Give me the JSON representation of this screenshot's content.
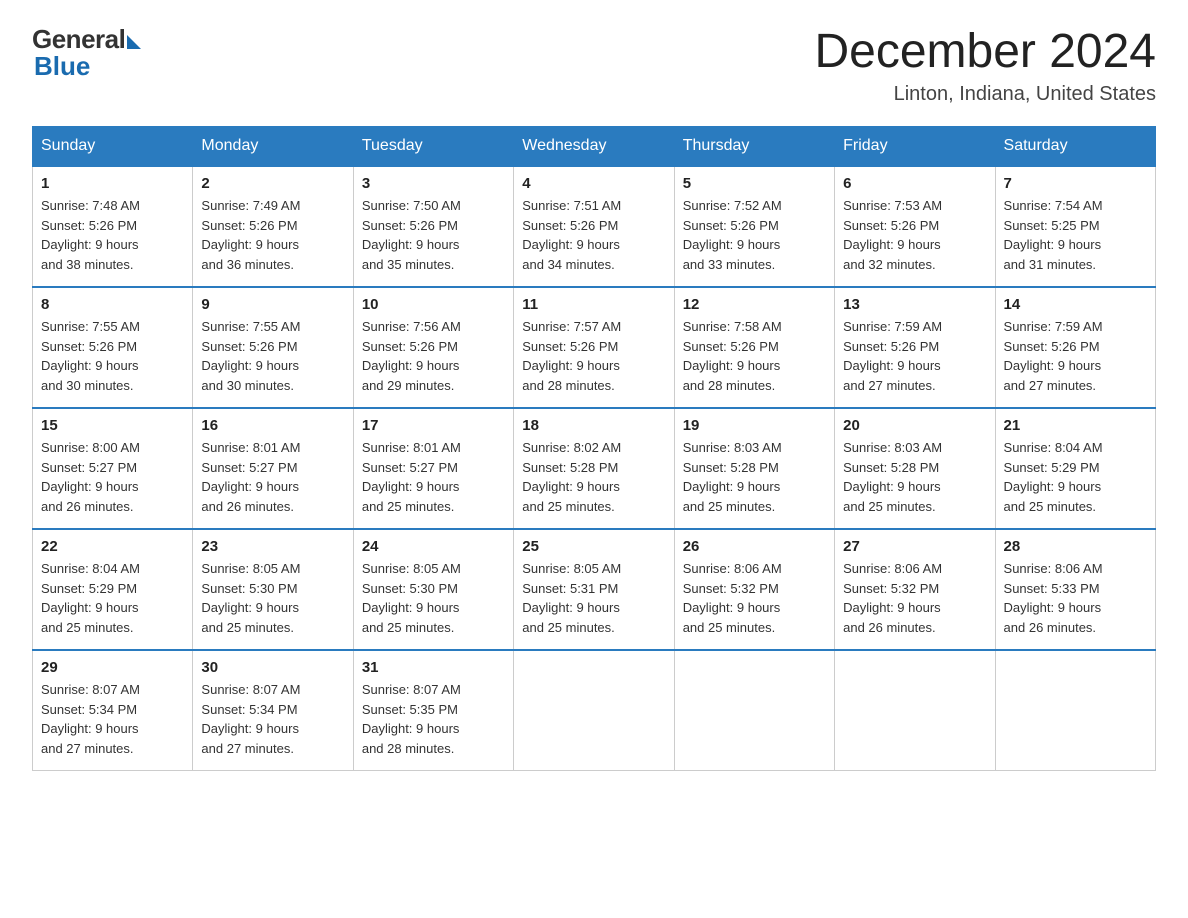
{
  "logo": {
    "general": "General",
    "blue": "Blue"
  },
  "title": "December 2024",
  "location": "Linton, Indiana, United States",
  "days_of_week": [
    "Sunday",
    "Monday",
    "Tuesday",
    "Wednesday",
    "Thursday",
    "Friday",
    "Saturday"
  ],
  "weeks": [
    [
      {
        "day": "1",
        "sunrise": "7:48 AM",
        "sunset": "5:26 PM",
        "daylight": "9 hours and 38 minutes."
      },
      {
        "day": "2",
        "sunrise": "7:49 AM",
        "sunset": "5:26 PM",
        "daylight": "9 hours and 36 minutes."
      },
      {
        "day": "3",
        "sunrise": "7:50 AM",
        "sunset": "5:26 PM",
        "daylight": "9 hours and 35 minutes."
      },
      {
        "day": "4",
        "sunrise": "7:51 AM",
        "sunset": "5:26 PM",
        "daylight": "9 hours and 34 minutes."
      },
      {
        "day": "5",
        "sunrise": "7:52 AM",
        "sunset": "5:26 PM",
        "daylight": "9 hours and 33 minutes."
      },
      {
        "day": "6",
        "sunrise": "7:53 AM",
        "sunset": "5:26 PM",
        "daylight": "9 hours and 32 minutes."
      },
      {
        "day": "7",
        "sunrise": "7:54 AM",
        "sunset": "5:25 PM",
        "daylight": "9 hours and 31 minutes."
      }
    ],
    [
      {
        "day": "8",
        "sunrise": "7:55 AM",
        "sunset": "5:26 PM",
        "daylight": "9 hours and 30 minutes."
      },
      {
        "day": "9",
        "sunrise": "7:55 AM",
        "sunset": "5:26 PM",
        "daylight": "9 hours and 30 minutes."
      },
      {
        "day": "10",
        "sunrise": "7:56 AM",
        "sunset": "5:26 PM",
        "daylight": "9 hours and 29 minutes."
      },
      {
        "day": "11",
        "sunrise": "7:57 AM",
        "sunset": "5:26 PM",
        "daylight": "9 hours and 28 minutes."
      },
      {
        "day": "12",
        "sunrise": "7:58 AM",
        "sunset": "5:26 PM",
        "daylight": "9 hours and 28 minutes."
      },
      {
        "day": "13",
        "sunrise": "7:59 AM",
        "sunset": "5:26 PM",
        "daylight": "9 hours and 27 minutes."
      },
      {
        "day": "14",
        "sunrise": "7:59 AM",
        "sunset": "5:26 PM",
        "daylight": "9 hours and 27 minutes."
      }
    ],
    [
      {
        "day": "15",
        "sunrise": "8:00 AM",
        "sunset": "5:27 PM",
        "daylight": "9 hours and 26 minutes."
      },
      {
        "day": "16",
        "sunrise": "8:01 AM",
        "sunset": "5:27 PM",
        "daylight": "9 hours and 26 minutes."
      },
      {
        "day": "17",
        "sunrise": "8:01 AM",
        "sunset": "5:27 PM",
        "daylight": "9 hours and 25 minutes."
      },
      {
        "day": "18",
        "sunrise": "8:02 AM",
        "sunset": "5:28 PM",
        "daylight": "9 hours and 25 minutes."
      },
      {
        "day": "19",
        "sunrise": "8:03 AM",
        "sunset": "5:28 PM",
        "daylight": "9 hours and 25 minutes."
      },
      {
        "day": "20",
        "sunrise": "8:03 AM",
        "sunset": "5:28 PM",
        "daylight": "9 hours and 25 minutes."
      },
      {
        "day": "21",
        "sunrise": "8:04 AM",
        "sunset": "5:29 PM",
        "daylight": "9 hours and 25 minutes."
      }
    ],
    [
      {
        "day": "22",
        "sunrise": "8:04 AM",
        "sunset": "5:29 PM",
        "daylight": "9 hours and 25 minutes."
      },
      {
        "day": "23",
        "sunrise": "8:05 AM",
        "sunset": "5:30 PM",
        "daylight": "9 hours and 25 minutes."
      },
      {
        "day": "24",
        "sunrise": "8:05 AM",
        "sunset": "5:30 PM",
        "daylight": "9 hours and 25 minutes."
      },
      {
        "day": "25",
        "sunrise": "8:05 AM",
        "sunset": "5:31 PM",
        "daylight": "9 hours and 25 minutes."
      },
      {
        "day": "26",
        "sunrise": "8:06 AM",
        "sunset": "5:32 PM",
        "daylight": "9 hours and 25 minutes."
      },
      {
        "day": "27",
        "sunrise": "8:06 AM",
        "sunset": "5:32 PM",
        "daylight": "9 hours and 26 minutes."
      },
      {
        "day": "28",
        "sunrise": "8:06 AM",
        "sunset": "5:33 PM",
        "daylight": "9 hours and 26 minutes."
      }
    ],
    [
      {
        "day": "29",
        "sunrise": "8:07 AM",
        "sunset": "5:34 PM",
        "daylight": "9 hours and 27 minutes."
      },
      {
        "day": "30",
        "sunrise": "8:07 AM",
        "sunset": "5:34 PM",
        "daylight": "9 hours and 27 minutes."
      },
      {
        "day": "31",
        "sunrise": "8:07 AM",
        "sunset": "5:35 PM",
        "daylight": "9 hours and 28 minutes."
      },
      null,
      null,
      null,
      null
    ]
  ],
  "sunrise_label": "Sunrise:",
  "sunset_label": "Sunset:",
  "daylight_label": "Daylight:"
}
